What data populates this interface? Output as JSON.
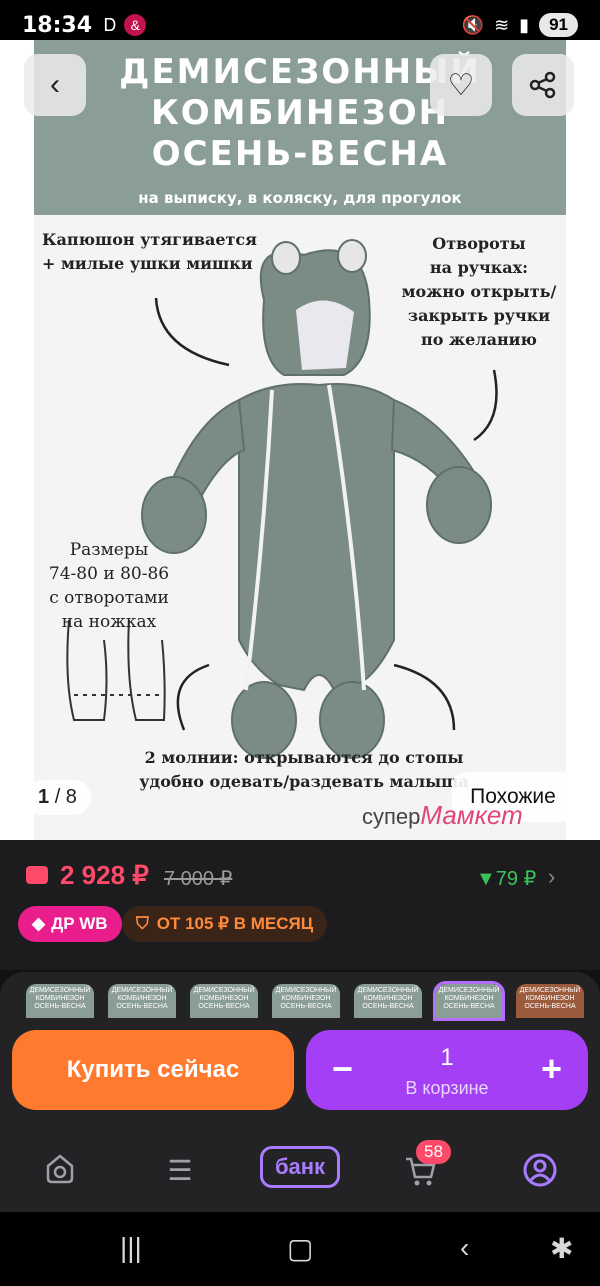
{
  "status_bar": {
    "time": "18:34",
    "battery": "91"
  },
  "product_image": {
    "title_line1": "ДЕМИСЕЗОННЫЙ",
    "title_line2": "КОМБИНЕЗОН",
    "title_line3": "ОСЕНЬ-ВЕСНА",
    "subtitle": "на выписку, в коляску, для прогулок",
    "cap_hood_1": "Капюшон утягивается",
    "cap_hood_2": "+ милые ушки мишки",
    "cap_cuffs_1": "Отвороты",
    "cap_cuffs_2": "на ручках:",
    "cap_cuffs_3": "можно открыть/",
    "cap_cuffs_4": "закрыть ручки",
    "cap_cuffs_5": "по желанию",
    "cap_sizes_1": "Размеры",
    "cap_sizes_2": "74-80 и 80-86",
    "cap_sizes_3": "с отворотами",
    "cap_sizes_4": "на ножках",
    "cap_zips_1": "2 молнии: открываются до стопы",
    "cap_zips_2": "удобно одевать/раздевать малыша",
    "brand_prefix": "супер",
    "brand_name": "Мамкет"
  },
  "gallery": {
    "current": "1",
    "total": "/ 8",
    "similar_label": "Похожие"
  },
  "price": {
    "current": "2 928 ₽",
    "old": "7 000 ₽",
    "cashback": "▼79 ₽",
    "badge_dr": "ДР WB",
    "badge_credit": "ОТ 105 ₽ В МЕСЯЦ"
  },
  "thumbnails": [
    "ДЕМИСЕЗОННЫЙ КОМБИНЕЗОН ОСЕНЬ-ВЕСНА",
    "ДЕМИСЕЗОННЫЙ КОМБИНЕЗОН ОСЕНЬ-ВЕСНА",
    "ДЕМИСЕЗОННЫЙ КОМБИНЕЗОН ОСЕНЬ-ВЕСНА",
    "ДЕМИСЕЗОННЫЙ КОМБИНЕЗОН ОСЕНЬ-ВЕСНА",
    "ДЕМИСЕЗОННЫЙ КОМБИНЕЗОН ОСЕНЬ-ВЕСНА",
    "ДЕМИСЕЗОННЫЙ КОМБИНЕЗОН ОСЕНЬ-ВЕСНА",
    "ДЕМИСЕЗОННЫЙ КОМБИНЕЗОН ОСЕНЬ-ВЕСНА"
  ],
  "actions": {
    "buy_now": "Купить сейчас",
    "minus": "−",
    "plus": "+",
    "quantity": "1",
    "in_cart": "В корзине"
  },
  "bottom_nav": {
    "bank": "банк",
    "cart_count": "58"
  },
  "colors": {
    "price": "#ff4a6a",
    "buy": "#ff7a2e",
    "cart": "#a53ff5",
    "accent": "#a87bff"
  }
}
